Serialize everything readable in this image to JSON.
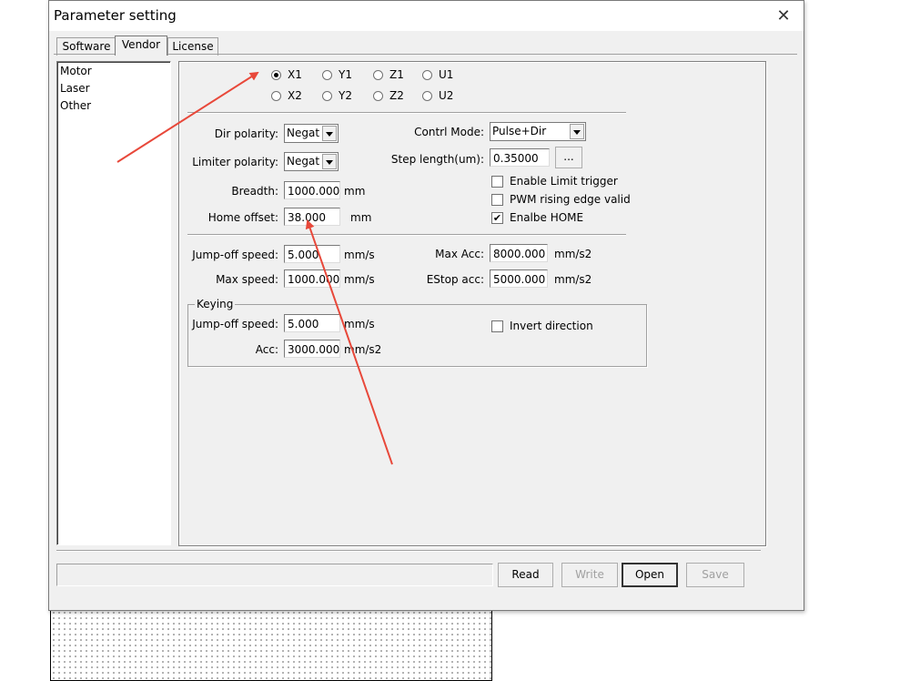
{
  "dialog": {
    "title": "Parameter setting",
    "close_symbol": "✕"
  },
  "tabs": [
    {
      "label": "Software",
      "active": false
    },
    {
      "label": "Vendor",
      "active": true
    },
    {
      "label": "License",
      "active": false
    }
  ],
  "categories": [
    "Motor",
    "Laser",
    "Other"
  ],
  "axes": {
    "selected": "X1",
    "row1": [
      "X1",
      "Y1",
      "Z1",
      "U1"
    ],
    "row2": [
      "X2",
      "Y2",
      "Z2",
      "U2"
    ]
  },
  "fields": {
    "dir_polarity": {
      "label": "Dir polarity:",
      "value": "Negat"
    },
    "limiter_polarity": {
      "label": "Limiter polarity:",
      "value": "Negat"
    },
    "breadth": {
      "label": "Breadth:",
      "value": "1000.000",
      "unit": "mm"
    },
    "home_offset": {
      "label": "Home offset:",
      "value": "38.000",
      "unit": "mm"
    },
    "control_mode": {
      "label": "Contrl Mode:",
      "value": "Pulse+Dir"
    },
    "step_length": {
      "label": "Step length(um):",
      "value": "0.35000",
      "button": "..."
    },
    "jump_off_speed": {
      "label": "Jump-off speed:",
      "value": "5.000",
      "unit": "mm/s"
    },
    "max_speed": {
      "label": "Max speed:",
      "value": "1000.000",
      "unit": "mm/s"
    },
    "max_acc": {
      "label": "Max Acc:",
      "value": "8000.000",
      "unit": "mm/s2"
    },
    "estop_acc": {
      "label": "EStop acc:",
      "value": "5000.000",
      "unit": "mm/s2"
    }
  },
  "checkboxes": [
    {
      "label": "Enable Limit trigger",
      "checked": false
    },
    {
      "label": "PWM rising edge valid",
      "checked": false
    },
    {
      "label": "Enalbe HOME",
      "checked": true
    }
  ],
  "keying": {
    "title": "Keying",
    "jump_off_speed": {
      "label": "Jump-off speed:",
      "value": "5.000",
      "unit": "mm/s"
    },
    "acc": {
      "label": "Acc:",
      "value": "3000.000",
      "unit": "mm/s2"
    },
    "invert_direction": {
      "label": "Invert direction",
      "checked": false
    }
  },
  "buttons": {
    "read": "Read",
    "write": "Write",
    "open": "Open",
    "save": "Save"
  },
  "colors": {
    "annotation_arrow": "#e8483a"
  }
}
